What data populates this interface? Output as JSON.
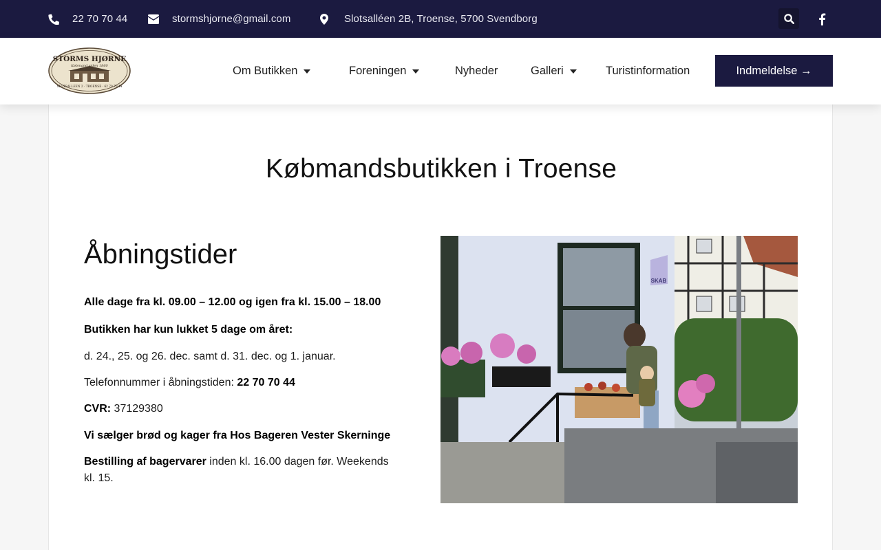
{
  "topbar": {
    "phone": "22 70 70 44",
    "email": "stormshjorne@gmail.com",
    "address": "Slotsalléen 2B, Troense, 5700 Svendborg"
  },
  "logo": {
    "name": "STORMS HJØRNE",
    "tagline": "Købmand siden 1860",
    "footer": "SLOTSALLEEN 2 · TROENSE · 62 70 70 44"
  },
  "nav": {
    "om_butikken": "Om Butikken",
    "foreningen": "Foreningen",
    "nyheder": "Nyheder",
    "galleri": "Galleri",
    "turistinformation": "Turistinformation",
    "cta": "Indmeldelse →"
  },
  "main": {
    "title": "Købmandsbutikken i Troense",
    "section_title": "Åbningstider",
    "hours": "Alle dage fra kl. 09.00 – 12.00 og igen fra kl. 15.00 – 18.00",
    "closed_heading": "Butikken har kun lukket 5 dage om året:",
    "closed_days": "d. 24., 25. og 26. dec. samt d. 31. dec. og 1. januar.",
    "phone_label": "Telefonnummer i åbningstiden: ",
    "phone_value": "22 70 70 44",
    "cvr_label": "CVR:",
    "cvr_value": " 37129380",
    "bread": "Vi sælger brød og kager fra Hos Bageren Vester Skerninge",
    "order_label": "Bestilling af bagervarer",
    "order_text": " inden kl. 16.00 dagen før. Weekends kl. 15."
  },
  "photo": {
    "flag_text": "SKAB"
  },
  "colors": {
    "navy": "#1b1a40",
    "background": "#f6f6f6",
    "card": "#ffffff"
  },
  "icons": [
    "phone-icon",
    "mail-icon",
    "map-pin-icon",
    "search-icon",
    "facebook-icon",
    "chevron-down-icon"
  ]
}
